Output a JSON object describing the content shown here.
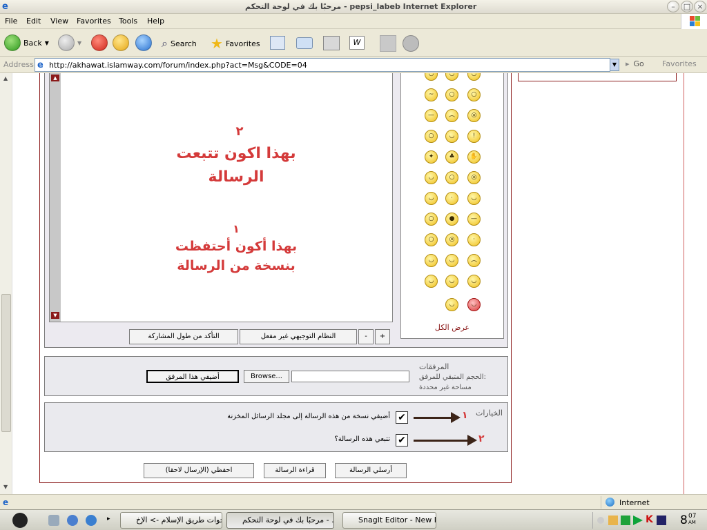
{
  "window": {
    "title": "مرحبًا بك في لوحة التحكم - pepsi_labeb Internet Explorer"
  },
  "menu": [
    "File",
    "Edit",
    "View",
    "Favorites",
    "Tools",
    "Help"
  ],
  "toolbar": {
    "back": "Back",
    "search": "Search",
    "favorites": "Favorites"
  },
  "address": {
    "label": "Address",
    "url": "http://akhawat.islamway.com/forum/index.php?act=Msg&CODE=04",
    "go": "Go",
    "favorites_btn": "Favorites"
  },
  "editor": {
    "annotation_2_num": "٢",
    "annotation_2_l1": "بهذا اكون تتبعت",
    "annotation_2_l2": "الرسالة",
    "annotation_1_num": "١",
    "annotation_1_l1": "بهذا أكون أحتفظت",
    "annotation_1_l2": "بنسخة من الرسالة",
    "plus_btn": "+",
    "minus_btn": "-",
    "guided_mode_btn": "النظام التوجيهي غير مفعل",
    "check_length_btn": "التأكد من طول المشاركة"
  },
  "emoticons": {
    "show_all": "عرض الكل"
  },
  "attachments": {
    "title": "المرفقات",
    "remaining_label": "الحجم المتبقي للمرفق:",
    "remaining_value": "مساحة غير محددة",
    "browse": "Browse...",
    "add_btn": "أضيفي هذا المرفق",
    "file_value": ""
  },
  "options": {
    "title": "الخيارات",
    "opt1": "أضيفي نسخة من هذه الرسالة إلى مجلد الرسائل المخزنة",
    "opt2": "تتبعي هذه الرسالة؟",
    "mark1": "١",
    "mark2": "٢"
  },
  "actions": {
    "send": "أرسلي الرسالة",
    "preview": "قراءة الرسالة",
    "save": "احفظي (الإرسال لاحقا)"
  },
  "status": {
    "zone": "Internet"
  },
  "taskbar": {
    "task1": "أخوات طريق الإسلام -> الإخ...",
    "task2": "مرحبًا بك في لوحة التحكم - ...",
    "task3": "SnagIt Editor - New I...",
    "clock_hour": "8",
    "clock_min": "07",
    "clock_ampm": "AM"
  },
  "colors": {
    "annotation_red": "#d43a3a",
    "arrow": "#3c2418",
    "frame_red": "#8b1a1a"
  }
}
